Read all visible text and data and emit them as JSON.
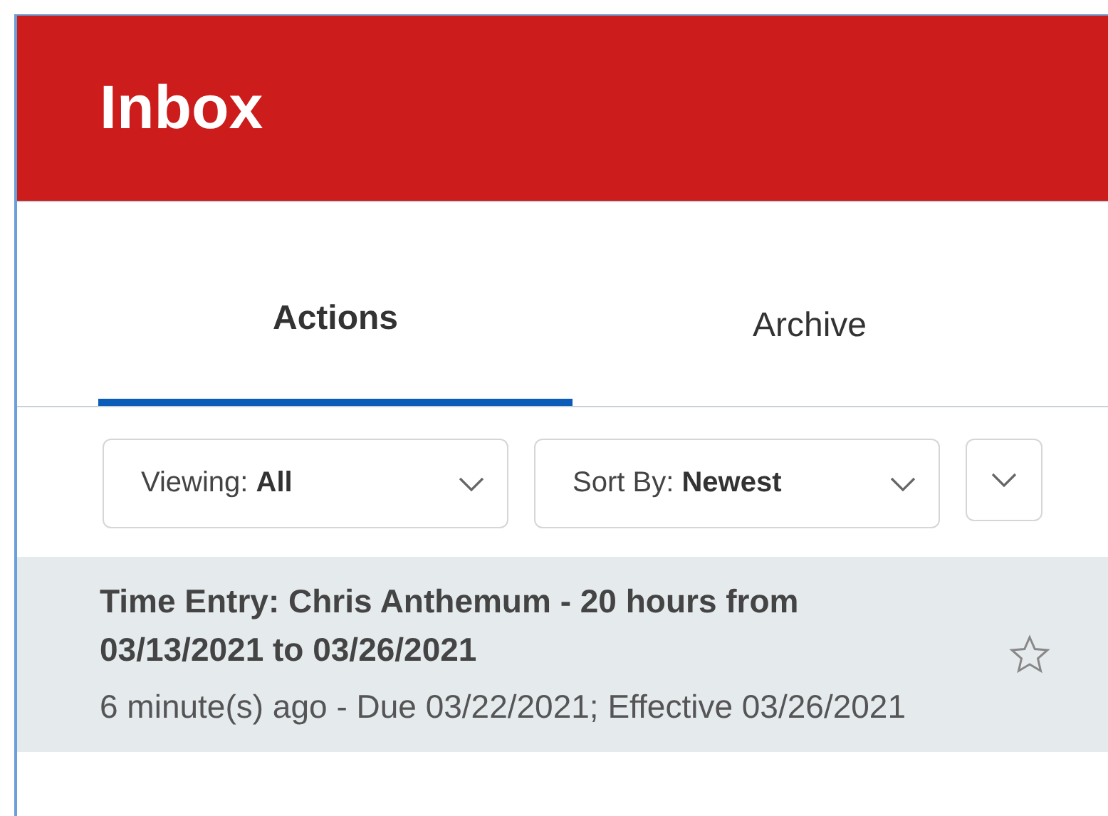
{
  "header": {
    "title": "Inbox"
  },
  "tabs": [
    {
      "label": "Actions",
      "selected": true
    },
    {
      "label": "Archive",
      "selected": false
    }
  ],
  "filters": [
    {
      "label": "Viewing:",
      "value": "All"
    },
    {
      "label": "Sort By:",
      "value": "Newest"
    }
  ],
  "items": [
    {
      "title": "Time Entry: Chris Anthemum - 20 hours from 03/13/2021 to 03/26/2021",
      "subtitle": "6 minute(s) ago - Due 03/22/2021; Effective 03/26/2021",
      "selected": true,
      "starred": false
    }
  ]
}
